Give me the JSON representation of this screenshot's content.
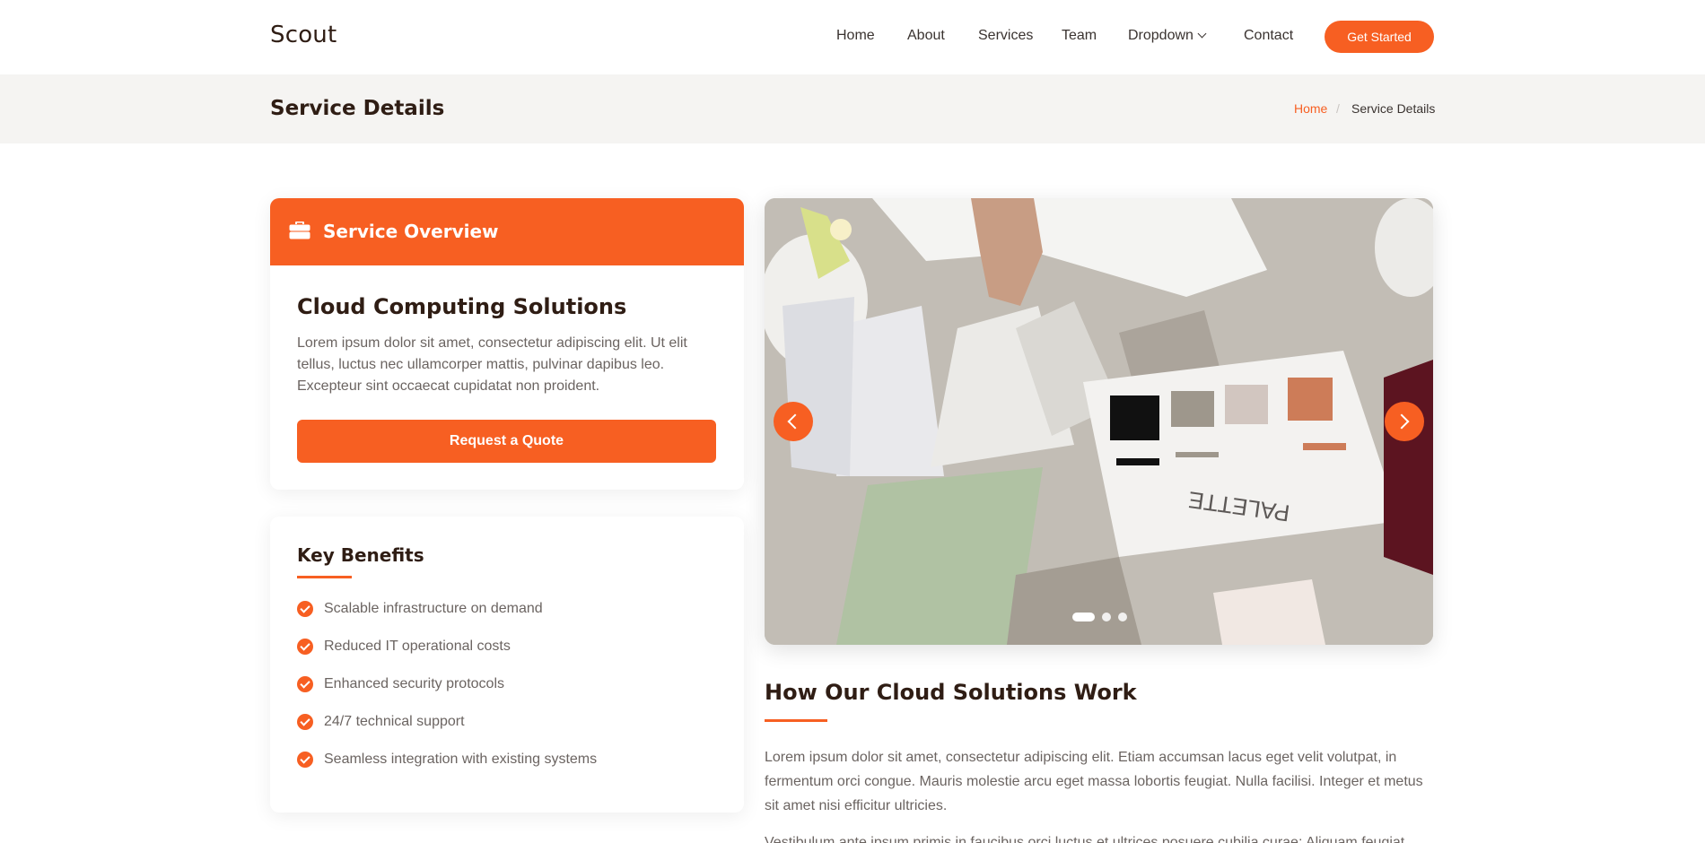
{
  "brand": {
    "logo_text": "Scout",
    "accent_color": "#f75f22"
  },
  "nav": {
    "items": [
      "Home",
      "About",
      "Services",
      "Team",
      "Dropdown",
      "Contact"
    ],
    "cta_label": "Get Started"
  },
  "page": {
    "title": "Service Details",
    "breadcrumb": {
      "home": "Home",
      "separator": "/",
      "current": "Service Details"
    }
  },
  "overview": {
    "header": "Service Overview",
    "header_icon": "briefcase-icon",
    "service_name": "Cloud Computing Solutions",
    "description": "Lorem ipsum dolor sit amet, consectetur adipiscing elit. Ut elit tellus, luctus nec ullamcorper mattis, pulvinar dapibus leo. Excepteur sint occaecat cupidatat non proident.",
    "button_label": "Request a Quote"
  },
  "benefits": {
    "title": "Key Benefits",
    "items": [
      "Scalable infrastructure on demand",
      "Reduced IT operational costs",
      "Enhanced security protocols",
      "24/7 technical support",
      "Seamless integration with existing systems"
    ]
  },
  "carousel": {
    "image_label": "PALETTE",
    "slide_count": 3,
    "active_slide": 1,
    "prev_icon": "chevron-left-icon",
    "next_icon": "chevron-right-icon"
  },
  "article": {
    "title": "How Our Cloud Solutions Work",
    "paragraph1": "Lorem ipsum dolor sit amet, consectetur adipiscing elit. Etiam accumsan lacus eget velit volutpat, in fermentum orci congue. Mauris molestie arcu eget massa lobortis feugiat. Nulla facilisi. Integer et metus sit amet nisi efficitur ultricies.",
    "paragraph2": "Vestibulum ante ipsum primis in faucibus orci luctus et ultrices posuere cubilia curae; Aliquam feugiat"
  }
}
